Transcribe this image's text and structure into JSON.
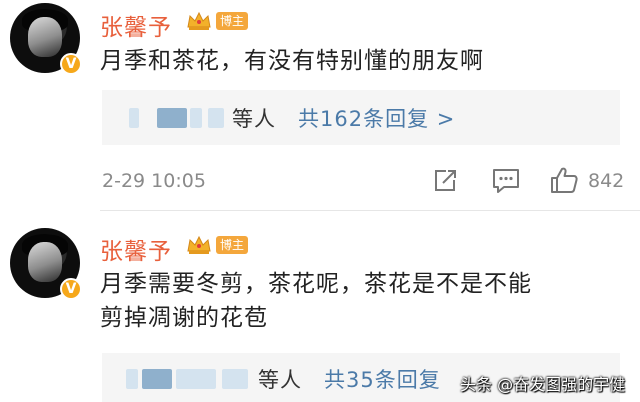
{
  "posts": [
    {
      "username": "张馨予",
      "badge": "博主",
      "comment": "月季和茶花，有没有特别懂的朋友啊",
      "reply_suffix": "等人",
      "reply_link": "共162条回复 >",
      "time": "2-29 10:05",
      "likes": "842"
    },
    {
      "username": "张馨予",
      "badge": "博主",
      "comment": "月季需要冬剪，茶花呢，茶花是不是不能剪掉凋谢的花苞",
      "reply_suffix": "等人",
      "reply_link": "共35条回复"
    }
  ],
  "avatar_verified_mark": "V",
  "watermark": "头条 @奋发图强的宇健",
  "icons": [
    "share-icon",
    "comment-icon",
    "like-icon",
    "crown-icon",
    "verified-icon"
  ],
  "colors": {
    "username": "#e8603c",
    "link": "#4b7aa8",
    "badge": "#f4a73c",
    "verified": "#f6a81b"
  }
}
